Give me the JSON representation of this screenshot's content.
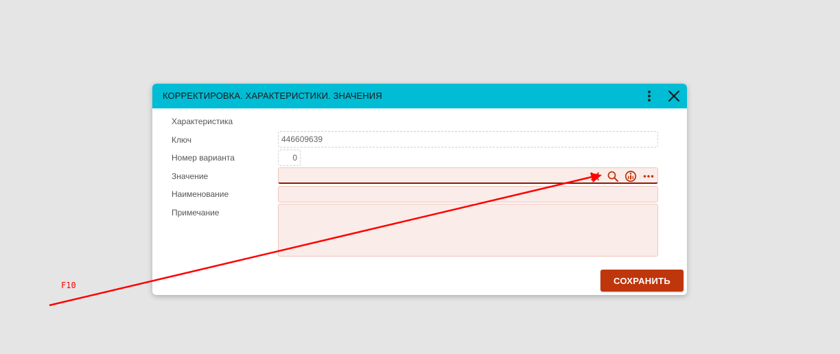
{
  "dialog": {
    "title": "КОРРЕКТИРОВКА. ХАРАКТЕРИСТИКИ. ЗНАЧЕНИЯ",
    "menu_icon": "kebab-menu-icon",
    "close_icon": "close-icon"
  },
  "form": {
    "characteristic": {
      "label": "Характеристика"
    },
    "key": {
      "label": "Ключ",
      "value": "446609639"
    },
    "variant_number": {
      "label": "Номер варианта",
      "value": "0"
    },
    "value": {
      "label": "Значение",
      "value": "",
      "icons": [
        "clear-icon",
        "search-icon",
        "info-icon",
        "more-icon"
      ]
    },
    "name": {
      "label": "Наименование",
      "value": ""
    },
    "note": {
      "label": "Примечание",
      "value": ""
    }
  },
  "actions": {
    "save_label": "СОХРАНИТЬ"
  },
  "annotation": {
    "label": "F10"
  },
  "colors": {
    "page_background": "#e5e5e5",
    "header_background": "#00bcd4",
    "required_field_background": "#faece8",
    "field_icons": "#bf360c",
    "save_button": "#bf360c",
    "annotation": "#ff0000"
  }
}
